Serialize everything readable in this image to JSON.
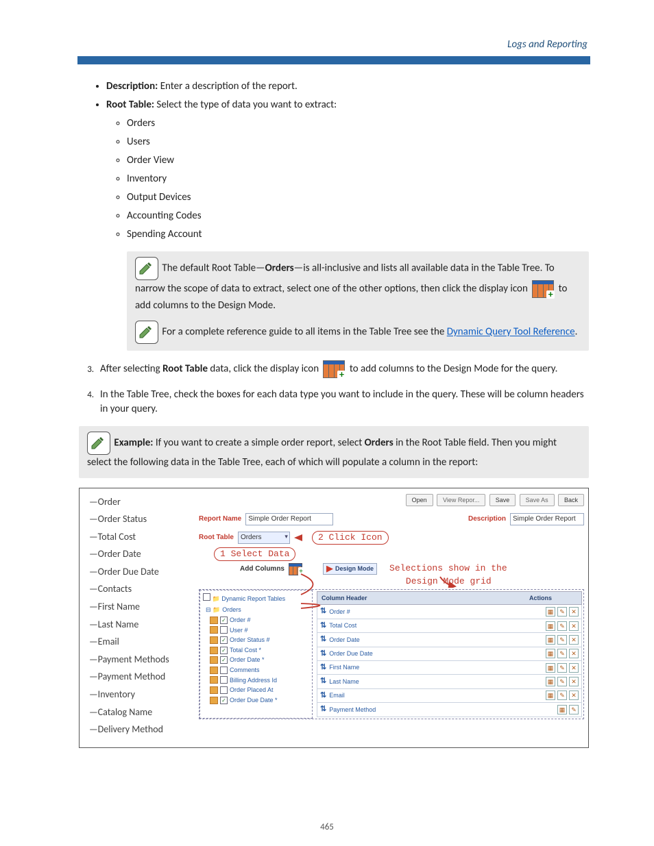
{
  "header": {
    "section_title": "Logs and Reporting"
  },
  "intro_list": {
    "description_label": "Description:",
    "description_text": " Enter a description of the report.",
    "root_table_label": "Root Table:",
    "root_table_text": " Select the type of data you want to extract:",
    "root_options": [
      "Orders",
      "Users",
      "Order View",
      "Inventory",
      "Output Devices",
      "Accounting Codes",
      "Spending Account"
    ]
  },
  "note1": {
    "pre": "The default Root Table—",
    "bold": "Orders",
    "post1": "—is all-inclusive and lists all available data in the Table Tree. To narrow the scope of data to extract, select one of the other options, then click the display icon ",
    "post2": " to add columns to the Design Mode."
  },
  "note2": {
    "pre": "For a complete reference guide to all items in the Table Tree see the ",
    "link": "Dynamic Query Tool Reference",
    "post": "."
  },
  "steps": {
    "s3_a": "After selecting ",
    "s3_b": "Root Table",
    "s3_c": " data, click the display icon ",
    "s3_d": "to add columns to the Design Mode for the query.",
    "s4": "In the Table Tree, check the boxes for each data type you want to include in the query. These will be column headers in your query."
  },
  "example": {
    "label": "Example:",
    "a": " If you want to create a simple order report, select ",
    "b": "Orders",
    "c": " in the Root Table field. Then you might select the following data in the Table Tree, each of which will populate a column in the report:"
  },
  "shot": {
    "sidebar_items": [
      "—Order",
      "—Order Status",
      "—Total Cost",
      "—Order Date",
      "—Order Due Date",
      "—Contacts",
      "—First Name",
      "—Last Name",
      "—Email",
      "—Payment Methods",
      "—Payment Method",
      "—Inventory",
      "—Catalog Name",
      "—Delivery Method"
    ],
    "toolbar": {
      "open": "Open",
      "view": "View Repor...",
      "save": "Save",
      "saveas": "Save As",
      "back": "Back"
    },
    "report_name_label": "Report Name",
    "report_name_value": "Simple Order Report",
    "description_label": "Description",
    "description_value": "Simple Order Report",
    "root_table_label": "Root Table",
    "root_table_value": "Orders",
    "callout_click": "2 Click Icon",
    "callout_select": "1 Select Data",
    "add_columns": "Add Columns",
    "design_mode": "Design Mode",
    "callout_grid1": "Selections show in the",
    "callout_grid2": "Design Mode grid",
    "tree_title": "Dynamic Report Tables",
    "tree_items": [
      {
        "label": "Orders",
        "checked": false,
        "root": true
      },
      {
        "label": "Order #",
        "checked": true
      },
      {
        "label": "User #",
        "checked": false
      },
      {
        "label": "Order Status #",
        "checked": true
      },
      {
        "label": "Total Cost *",
        "checked": true
      },
      {
        "label": "Order Date *",
        "checked": true
      },
      {
        "label": "Comments",
        "checked": false
      },
      {
        "label": "Billing Address Id",
        "checked": false
      },
      {
        "label": "Order Placed At",
        "checked": false
      },
      {
        "label": "Order Due Date *",
        "checked": true
      }
    ],
    "grid_header_l": "Column Header",
    "grid_header_r": "Actions",
    "grid_rows": [
      "Order #",
      "Total Cost",
      "Order Date",
      "Order Due Date",
      "First Name",
      "Last Name",
      "Email",
      "Payment Method"
    ]
  },
  "footer": {
    "page": "465"
  }
}
